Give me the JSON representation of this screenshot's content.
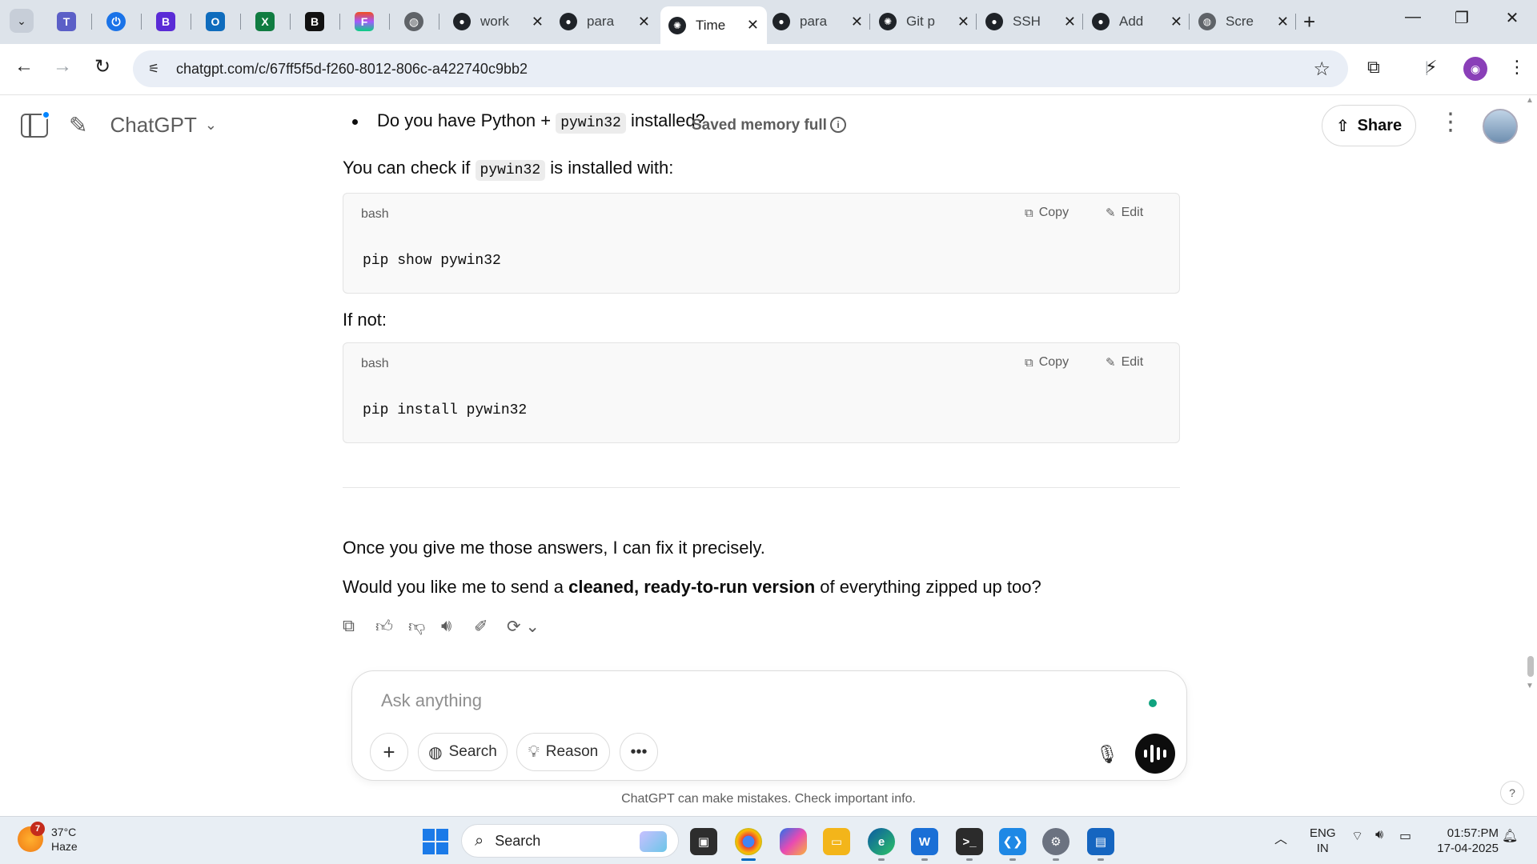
{
  "browser": {
    "tabs": [
      {
        "title": "work",
        "icon": "github-icon"
      },
      {
        "title": "para",
        "icon": "github-icon"
      },
      {
        "title": "Time",
        "icon": "openai-icon",
        "active": true
      },
      {
        "title": "para",
        "icon": "github-icon"
      },
      {
        "title": "Git p",
        "icon": "openai-icon"
      },
      {
        "title": "SSH",
        "icon": "github-icon"
      },
      {
        "title": "Add",
        "icon": "github-icon"
      },
      {
        "title": "Scre",
        "icon": "globe-icon"
      }
    ],
    "url": "chatgpt.com/c/67ff5f5d-f260-8012-806c-a422740c9bb2"
  },
  "header": {
    "brand": "ChatGPT",
    "memory_notice": "Saved memory full",
    "share_label": "Share"
  },
  "conversation": {
    "bullet": {
      "pre": "Do you have Python + ",
      "code": "pywin32",
      "post": " installed?"
    },
    "check_line": {
      "pre": "You can check if ",
      "code": "pywin32",
      "post": " is installed with:"
    },
    "code_blocks": [
      {
        "lang": "bash",
        "copy": "Copy",
        "edit": "Edit",
        "code": "pip show pywin32"
      },
      {
        "lang": "bash",
        "copy": "Copy",
        "edit": "Edit",
        "code": "pip install pywin32"
      }
    ],
    "if_not": "If not:",
    "closing": "Once you give me those answers, I can fix it precisely.",
    "question": {
      "pre": "Would you like me to send a ",
      "bold": "cleaned, ready-to-run version",
      "post": " of everything zipped up too?"
    }
  },
  "composer": {
    "placeholder": "Ask anything",
    "search_label": "Search",
    "reason_label": "Reason"
  },
  "disclaimer": "ChatGPT can make mistakes. Check important info.",
  "taskbar": {
    "weather": {
      "temp": "37°C",
      "condition": "Haze",
      "badge": "7"
    },
    "search_label": "Search",
    "lang_top": "ENG",
    "lang_bottom": "IN",
    "time": "01:57:PM",
    "date": "17-04-2025"
  },
  "colors": {
    "accent_blue": "#0285ff",
    "memory_text": "#5d5d5d",
    "taskbar_bg": "#e8eef4",
    "tabstrip_bg": "#dde3ea"
  }
}
